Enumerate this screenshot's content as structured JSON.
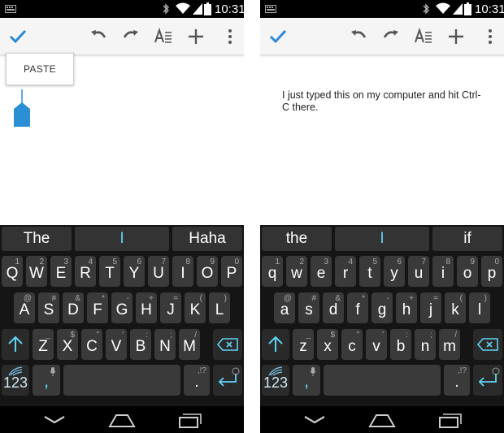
{
  "status": {
    "time": "10:31"
  },
  "left": {
    "paste_label": "PASTE",
    "suggestions": [
      "The",
      "I",
      "Haha"
    ],
    "rows": [
      [
        {
          "k": "Q",
          "s": "1"
        },
        {
          "k": "W",
          "s": "2"
        },
        {
          "k": "E",
          "s": "3"
        },
        {
          "k": "R",
          "s": "4"
        },
        {
          "k": "T",
          "s": "5"
        },
        {
          "k": "Y",
          "s": "6"
        },
        {
          "k": "U",
          "s": "7"
        },
        {
          "k": "I",
          "s": "8"
        },
        {
          "k": "O",
          "s": "9"
        },
        {
          "k": "P",
          "s": "0"
        }
      ],
      [
        {
          "k": "A",
          "s": "@"
        },
        {
          "k": "S",
          "s": "#"
        },
        {
          "k": "D",
          "s": "&"
        },
        {
          "k": "F",
          "s": "*"
        },
        {
          "k": "G",
          "s": "-"
        },
        {
          "k": "H",
          "s": "+"
        },
        {
          "k": "J",
          "s": "="
        },
        {
          "k": "K",
          "s": "("
        },
        {
          "k": "L",
          "s": ")"
        }
      ],
      [
        {
          "k": "Z",
          "s": "_"
        },
        {
          "k": "X",
          "s": "$"
        },
        {
          "k": "C",
          "s": "\""
        },
        {
          "k": "V",
          "s": "'"
        },
        {
          "k": "B",
          "s": ":"
        },
        {
          "k": "N",
          "s": ";"
        },
        {
          "k": "M",
          "s": "/"
        }
      ]
    ]
  },
  "right": {
    "doc_text": "I just typed this on my computer and hit Ctrl-C there.",
    "suggestions": [
      "the",
      "I",
      "if"
    ],
    "rows": [
      [
        {
          "k": "q",
          "s": "1"
        },
        {
          "k": "w",
          "s": "2"
        },
        {
          "k": "e",
          "s": "3"
        },
        {
          "k": "r",
          "s": "4"
        },
        {
          "k": "t",
          "s": "5"
        },
        {
          "k": "y",
          "s": "6"
        },
        {
          "k": "u",
          "s": "7"
        },
        {
          "k": "i",
          "s": "8"
        },
        {
          "k": "o",
          "s": "9"
        },
        {
          "k": "p",
          "s": "0"
        }
      ],
      [
        {
          "k": "a",
          "s": "@"
        },
        {
          "k": "s",
          "s": "#"
        },
        {
          "k": "d",
          "s": "&"
        },
        {
          "k": "f",
          "s": "*"
        },
        {
          "k": "g",
          "s": "-"
        },
        {
          "k": "h",
          "s": "+"
        },
        {
          "k": "j",
          "s": "="
        },
        {
          "k": "k",
          "s": "("
        },
        {
          "k": "l",
          "s": ")"
        }
      ],
      [
        {
          "k": "z",
          "s": "_"
        },
        {
          "k": "x",
          "s": "$"
        },
        {
          "k": "c",
          "s": "\""
        },
        {
          "k": "v",
          "s": "'"
        },
        {
          "k": "b",
          "s": ":"
        },
        {
          "k": "n",
          "s": ";"
        },
        {
          "k": "m",
          "s": "/"
        }
      ]
    ]
  },
  "keys": {
    "numbers": "123",
    "comma": ",",
    "period": ".",
    "period_sec": ",!?"
  },
  "colors": {
    "accent": "#2b88d8",
    "suggestion_highlight": "#5ed3f3",
    "shift": "#5ed3f3",
    "key": "#3a3a3a"
  },
  "icons": [
    "check-icon",
    "undo-icon",
    "redo-icon",
    "text-format-icon",
    "add-icon",
    "more-vert-icon",
    "backspace-icon",
    "shift-icon",
    "enter-icon",
    "microphone-icon",
    "swiftkey-icon",
    "back-nav-icon",
    "home-nav-icon",
    "recents-nav-icon"
  ]
}
